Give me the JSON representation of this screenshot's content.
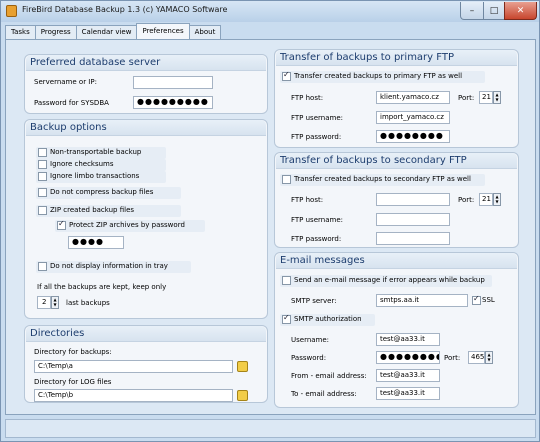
{
  "window": {
    "title": "FireBird Database Backup 1.3   (c) YAMACO Software",
    "min": "–",
    "max": "□",
    "close": "✕"
  },
  "tabs": [
    "Tasks",
    "Progress",
    "Calendar view",
    "Preferences",
    "About"
  ],
  "preferred": {
    "title": "Preferred database server",
    "server_label": "Servername or IP:",
    "server_value": "",
    "password_label": "Password for SYSDBA",
    "password_value": "●●●●●●●●●"
  },
  "backup": {
    "title": "Backup options",
    "non_transportable": "Non-transportable backup",
    "ignore_checksums": "Ignore checksums",
    "ignore_limbo": "Ignore limbo transactions",
    "no_compress": "Do not compress backup files",
    "zip": "ZIP created backup files",
    "protect_zip": "Protect ZIP archives by password",
    "zip_password": "●●●●",
    "no_tray": "Do not display information in tray",
    "keep_label": "If all the backups are kept, keep only",
    "keep_value": "2",
    "keep_suffix": "last backups"
  },
  "directories": {
    "title": "Directories",
    "backups_label": "Directory for backups:",
    "backups_value": "C:\\Temp\\a",
    "log_label": "Directory for LOG files",
    "log_value": "C:\\Temp\\b"
  },
  "ftp_primary": {
    "title": "Transfer of backups to primary FTP",
    "enable": "Transfer created backups to primary FTP as well",
    "host_label": "FTP host:",
    "host_value": "klient.yamaco.cz",
    "port_label": "Port:",
    "port_value": "21",
    "user_label": "FTP username:",
    "user_value": "import_yamaco.cz",
    "pass_label": "FTP password:",
    "pass_value": "●●●●●●●●"
  },
  "ftp_secondary": {
    "title": "Transfer of backups to secondary FTP",
    "enable": "Transfer created backups to secondary FTP as well",
    "host_label": "FTP host:",
    "host_value": "",
    "port_label": "Port:",
    "port_value": "21",
    "user_label": "FTP username:",
    "user_value": "",
    "pass_label": "FTP password:",
    "pass_value": ""
  },
  "email": {
    "title": "E-mail messages",
    "enable": "Send an e-mail message if error appears while backup",
    "smtp_label": "SMTP server:",
    "smtp_value": "smtps.aa.it",
    "ssl": "SSL",
    "smtp_auth": "SMTP authorization",
    "user_label": "Username:",
    "user_value": "test@aa33.it",
    "pass_label": "Password:",
    "pass_value": "●●●●●●●●●●",
    "port_label": "Port:",
    "port_value": "465",
    "from_label": "From - email address:",
    "from_value": "test@aa33.it",
    "to_label": "To - email address:",
    "to_value": "test@aa33.it"
  }
}
